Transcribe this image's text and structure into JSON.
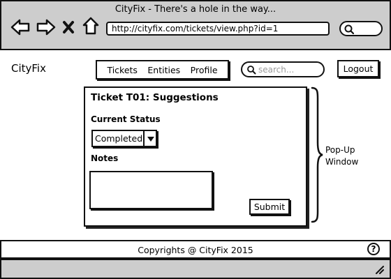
{
  "browser": {
    "title": "CityFix - There's a hole in the way...",
    "url": "http://cityfix.com/tickets/view.php?id=1",
    "nav_icons": [
      "back-arrow-icon",
      "forward-arrow-icon",
      "close-x-icon",
      "home-icon"
    ],
    "search_icon": "search-icon"
  },
  "header": {
    "brand": "CityFix",
    "nav": [
      "Tickets",
      "Entities",
      "Profile"
    ],
    "search_placeholder": "search...",
    "logout": "Logout"
  },
  "popup": {
    "title": "Ticket T01: Suggestions",
    "status_label": "Current Status",
    "status_value": "Completed",
    "notes_label": "Notes",
    "notes_value": "",
    "submit": "Submit"
  },
  "annotation": {
    "line1": "Pop-Up",
    "line2": "Window"
  },
  "footer": {
    "copyright": "Copyrights @ CityFix 2015",
    "help": "?"
  },
  "colors": {
    "chrome": "#cdcdcd",
    "border": "#111111",
    "placeholder": "#9a9a9a"
  }
}
